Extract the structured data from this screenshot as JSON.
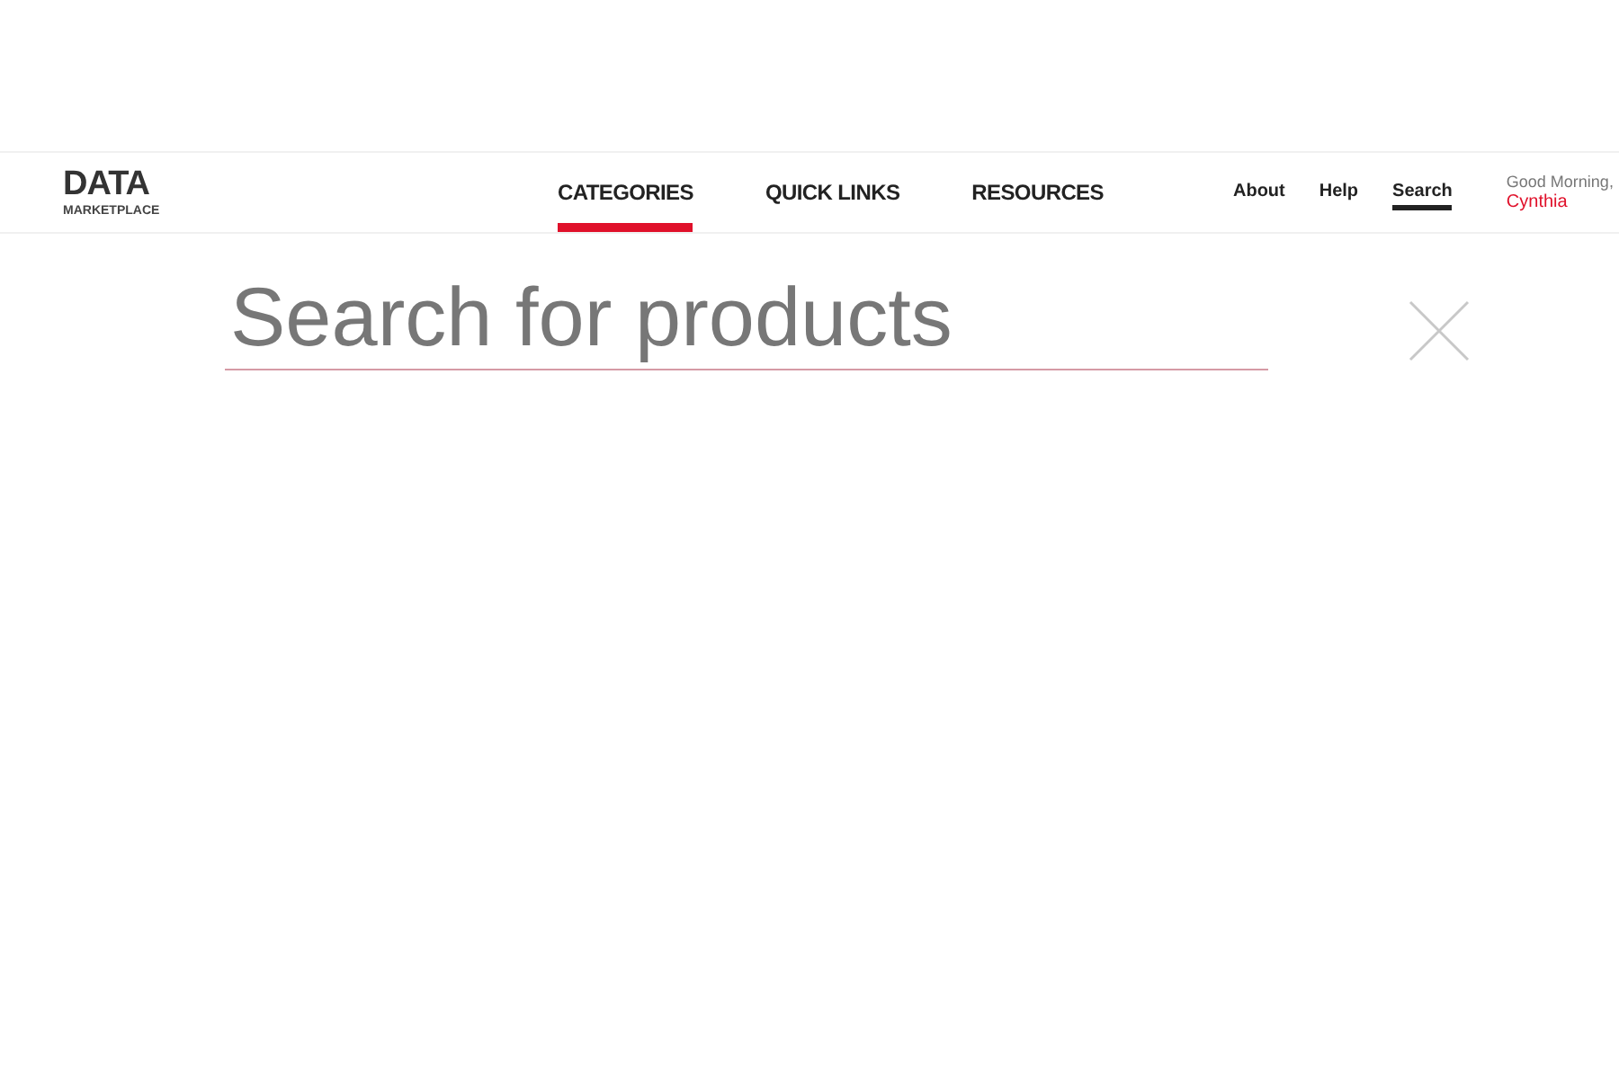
{
  "logo": {
    "title": "DATA",
    "subtitle": "MARKETPLACE"
  },
  "tabs": [
    {
      "label": "CATEGORIES",
      "selected": true
    },
    {
      "label": "QUICK LINKS",
      "selected": false
    },
    {
      "label": "RESOURCES",
      "selected": false
    }
  ],
  "utility_links": [
    {
      "label": "About",
      "selected": false
    },
    {
      "label": "Help",
      "selected": false
    },
    {
      "label": "Search",
      "selected": true
    }
  ],
  "greeting": {
    "text": "Good Morning,",
    "name": "Cynthia"
  },
  "search": {
    "placeholder": "Search for products"
  }
}
